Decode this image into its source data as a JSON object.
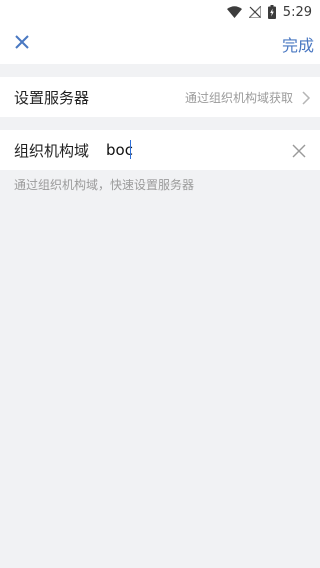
{
  "status_bar": {
    "time": "5:29",
    "icons": [
      "wifi-icon",
      "no-signal-icon",
      "battery-charging-icon"
    ]
  },
  "nav": {
    "close_icon": "close-icon",
    "done_label": "完成"
  },
  "server_row": {
    "label": "设置服务器",
    "value": "通过组织机构域获取",
    "chevron_icon": "chevron-right-icon"
  },
  "org_row": {
    "label": "组织机构域",
    "input_value": "boc",
    "clear_icon": "clear-icon"
  },
  "hint": "通过组织机构域，快速设置服务器",
  "colors": {
    "accent": "#4a78c2",
    "background": "#f1f2f4",
    "secondary_text": "#9b9b9b"
  }
}
